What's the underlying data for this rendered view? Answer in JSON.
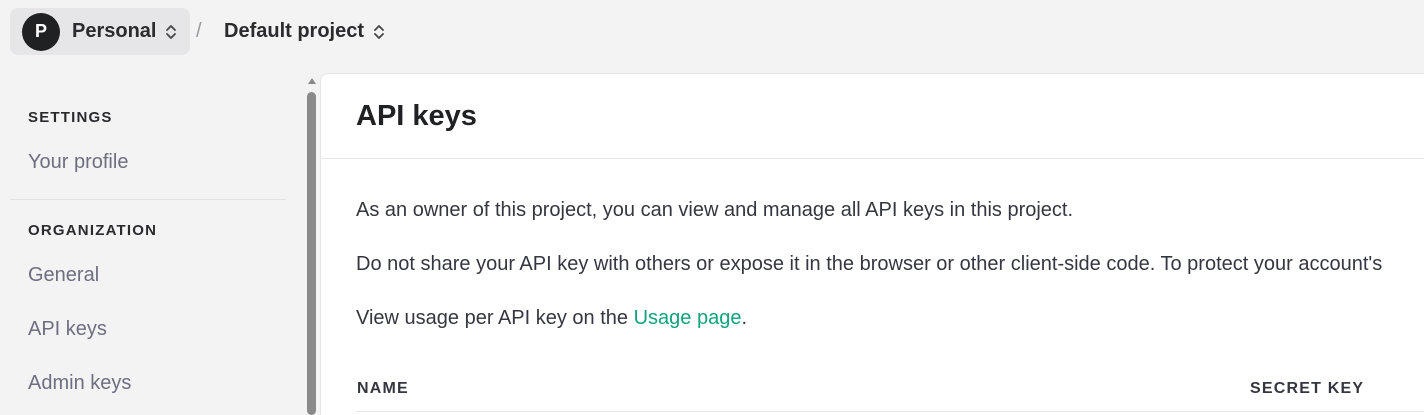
{
  "topbar": {
    "org": {
      "avatar_letter": "P",
      "name": "Personal"
    },
    "separator": "/",
    "project": {
      "name": "Default project"
    }
  },
  "sidebar": {
    "settings_title": "SETTINGS",
    "settings_items": [
      {
        "label": "Your profile"
      }
    ],
    "organization_title": "ORGANIZATION",
    "organization_items": [
      {
        "label": "General"
      },
      {
        "label": "API keys"
      },
      {
        "label": "Admin keys"
      }
    ]
  },
  "main": {
    "title": "API keys",
    "para1": "As an owner of this project, you can view and manage all API keys in this project.",
    "para2": "Do not share your API key with others or expose it in the browser or other client-side code. To protect your account's",
    "para3_prefix": "View usage per API key on the ",
    "para3_link": "Usage page",
    "para3_suffix": ".",
    "table": {
      "columns": [
        "NAME",
        "SECRET KEY"
      ]
    }
  },
  "colors": {
    "accent": "#10a37f",
    "avatar_bg": "#202123"
  }
}
